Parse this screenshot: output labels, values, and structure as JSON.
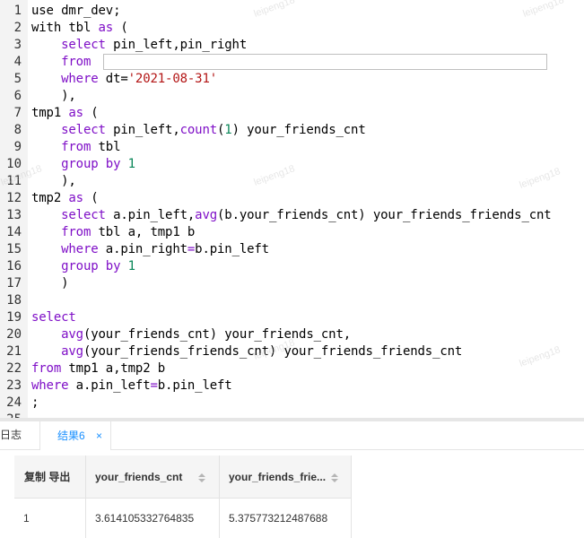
{
  "editor": {
    "lines": [
      {
        "n": "1",
        "segs": [
          [
            "plain",
            "use dmr_dev;"
          ]
        ]
      },
      {
        "n": "2",
        "segs": [
          [
            "plain",
            "with tbl "
          ],
          [
            "kw",
            "as"
          ],
          [
            "plain",
            " ("
          ]
        ]
      },
      {
        "n": "3",
        "segs": [
          [
            "plain",
            "    "
          ],
          [
            "kw",
            "select"
          ],
          [
            "plain",
            " pin_left,pin_right"
          ]
        ]
      },
      {
        "n": "4",
        "segs": [
          [
            "plain",
            "    "
          ],
          [
            "kw",
            "from"
          ]
        ]
      },
      {
        "n": "5",
        "segs": [
          [
            "plain",
            "    "
          ],
          [
            "kw",
            "where"
          ],
          [
            "plain",
            " dt="
          ],
          [
            "str",
            "'2021-08-31'"
          ]
        ]
      },
      {
        "n": "6",
        "segs": [
          [
            "plain",
            "    ),"
          ]
        ]
      },
      {
        "n": "7",
        "segs": [
          [
            "plain",
            "tmp1 "
          ],
          [
            "kw",
            "as"
          ],
          [
            "plain",
            " ("
          ]
        ]
      },
      {
        "n": "8",
        "segs": [
          [
            "plain",
            "    "
          ],
          [
            "kw",
            "select"
          ],
          [
            "plain",
            " pin_left,"
          ],
          [
            "kw",
            "count"
          ],
          [
            "plain",
            "("
          ],
          [
            "num",
            "1"
          ],
          [
            "plain",
            ") your_friends_cnt"
          ]
        ]
      },
      {
        "n": "9",
        "segs": [
          [
            "plain",
            "    "
          ],
          [
            "kw",
            "from"
          ],
          [
            "plain",
            " tbl"
          ]
        ]
      },
      {
        "n": "10",
        "segs": [
          [
            "plain",
            "    "
          ],
          [
            "kw",
            "group by"
          ],
          [
            "plain",
            " "
          ],
          [
            "num",
            "1"
          ]
        ]
      },
      {
        "n": "11",
        "segs": [
          [
            "plain",
            "    ),"
          ]
        ]
      },
      {
        "n": "12",
        "segs": [
          [
            "plain",
            "tmp2 "
          ],
          [
            "kw",
            "as"
          ],
          [
            "plain",
            " ("
          ]
        ]
      },
      {
        "n": "13",
        "segs": [
          [
            "plain",
            "    "
          ],
          [
            "kw",
            "select"
          ],
          [
            "plain",
            " a.pin_left,"
          ],
          [
            "kw",
            "avg"
          ],
          [
            "plain",
            "(b.your_friends_cnt) your_friends_friends_cnt"
          ]
        ]
      },
      {
        "n": "14",
        "segs": [
          [
            "plain",
            "    "
          ],
          [
            "kw",
            "from"
          ],
          [
            "plain",
            " tbl a, tmp1 b"
          ]
        ]
      },
      {
        "n": "15",
        "segs": [
          [
            "plain",
            "    "
          ],
          [
            "kw",
            "where"
          ],
          [
            "plain",
            " a.pin_right"
          ],
          [
            "kw",
            "="
          ],
          [
            "plain",
            "b.pin_left"
          ]
        ]
      },
      {
        "n": "16",
        "segs": [
          [
            "plain",
            "    "
          ],
          [
            "kw",
            "group by"
          ],
          [
            "plain",
            " "
          ],
          [
            "num",
            "1"
          ]
        ]
      },
      {
        "n": "17",
        "segs": [
          [
            "plain",
            "    )"
          ]
        ]
      },
      {
        "n": "18",
        "segs": []
      },
      {
        "n": "19",
        "segs": [
          [
            "kw",
            "select"
          ]
        ]
      },
      {
        "n": "20",
        "segs": [
          [
            "plain",
            "    "
          ],
          [
            "kw",
            "avg"
          ],
          [
            "plain",
            "(your_friends_cnt) your_friends_cnt,"
          ]
        ]
      },
      {
        "n": "21",
        "segs": [
          [
            "plain",
            "    "
          ],
          [
            "kw",
            "avg"
          ],
          [
            "plain",
            "(your_friends_friends_cnt) your_friends_friends_cnt"
          ]
        ]
      },
      {
        "n": "22",
        "segs": [
          [
            "kw",
            "from"
          ],
          [
            "plain",
            " tmp1 a,tmp2 b"
          ]
        ]
      },
      {
        "n": "23",
        "segs": [
          [
            "kw",
            "where"
          ],
          [
            "plain",
            " a.pin_left"
          ],
          [
            "kw",
            "="
          ],
          [
            "plain",
            "b.pin_left"
          ]
        ]
      },
      {
        "n": "24",
        "segs": [
          [
            "plain",
            ";"
          ]
        ]
      },
      {
        "n": "25",
        "segs": []
      }
    ],
    "watermark": "leipeng18"
  },
  "tabs": {
    "log_label": "日志",
    "result_label": "结果6",
    "close_glyph": "×",
    "active_color": "#1a90ff"
  },
  "results": {
    "toolbar_label": "复制 导出",
    "columns": [
      "your_friends_cnt",
      "your_friends_frie..."
    ],
    "rows": [
      [
        "1",
        "3.614105332764835",
        "5.375773212487688"
      ]
    ]
  }
}
